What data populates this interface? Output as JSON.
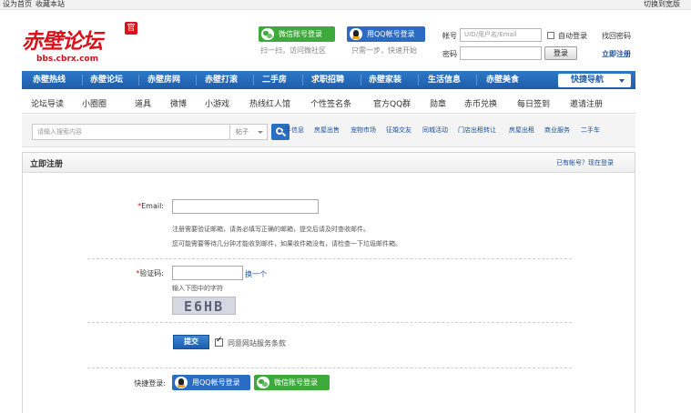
{
  "topbar": {
    "set_home": "设为首页",
    "bookmark": "收藏本站",
    "widescreen": "切换到宽版"
  },
  "logo": {
    "name": "赤壁论坛",
    "seal": "官",
    "url": "bbs.cbrx.com"
  },
  "social": {
    "wechat_label": "微信账号登录",
    "wechat_note": "扫一扫，访问微社区",
    "qq_label": "用QQ帐号登录",
    "qq_note": "只需一步，快速开始"
  },
  "login": {
    "account_label": "帐号",
    "account_placeholder": "UID/用户名/Email",
    "autologin": "自动登录",
    "forgot": "找回密码",
    "password_label": "密码",
    "login_button": "登录",
    "register": "立即注册"
  },
  "nav": {
    "items": [
      "赤壁热线",
      "赤壁论坛",
      "赤壁房网",
      "赤壁打滚",
      "二手房",
      "求职招聘",
      "赤壁家装",
      "生活信息",
      "赤壁美食"
    ],
    "quick_nav": "快捷导航"
  },
  "subnav": {
    "items": [
      "论坛导读",
      "小圈圈",
      "道具",
      "微博",
      "小游戏",
      "热线红人馆",
      "个性签名条",
      "官方QQ群",
      "勋章",
      "赤币兑换",
      "每日签到",
      "邀请注册"
    ]
  },
  "search": {
    "placeholder": "请输入搜索内容",
    "type": "帖子",
    "hot_links": [
      "二手信息",
      "房屋出售",
      "宠物市场",
      "征婚交友",
      "同城活动",
      "门店出租转让",
      "房屋出租",
      "商业服务",
      "二手车"
    ]
  },
  "panel": {
    "title": "立即注册",
    "have_account": "已有帐号？现在登录"
  },
  "form": {
    "email_label": "Email:",
    "email_hint1": "注册需要验证邮箱，请务必填写正确的邮箱，提交后请及时查收邮件。",
    "email_hint2": "您可能需要等待几分钟才能收到邮件，如果收件箱没有，请检查一下垃圾邮件箱。",
    "captcha_label": "验证码:",
    "captcha_refresh": "换一个",
    "captcha_hint": "输入下图中的字符",
    "captcha_text": "E6HB",
    "submit": "提交",
    "agree": "同意网站服务条款",
    "quick_login_label": "快捷登录:",
    "qq_login": "用QQ帐号登录",
    "wechat_login": "微信账号登录"
  }
}
